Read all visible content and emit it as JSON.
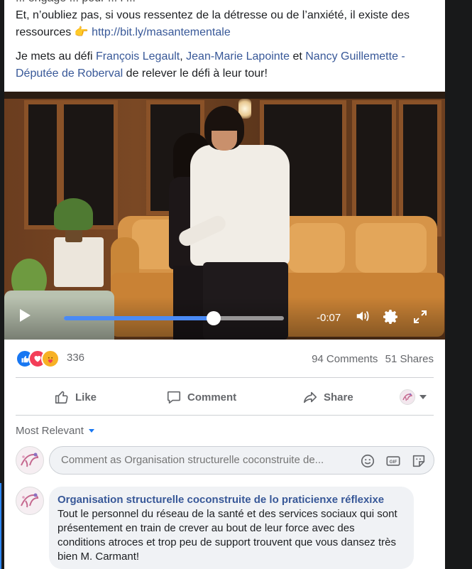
{
  "post": {
    "cut_line": "... engagé ... pour ... l ...",
    "line1_text": "Et, n’oubliez pas, si vous ressentez de la détresse ou de l’anxiété, il existe des ressources 👉 ",
    "line1_link": "http://bit.ly/masantementale",
    "line2_prefix": "Je mets au défi ",
    "tag1": "François Legault",
    "tag_sep1": ", ",
    "tag2": "Jean-Marie Lapointe",
    "tag_sep2": " et ",
    "tag3": "Nancy Guillemette - Députée de Roberval",
    "line2_suffix": " de relever le défi à leur tour!"
  },
  "video": {
    "time_remaining": "-0:07",
    "progress_percent": 68
  },
  "reactions": {
    "count": "336",
    "comments": "94 Comments",
    "shares": "51 Shares"
  },
  "actions": {
    "like": "Like",
    "comment": "Comment",
    "share": "Share"
  },
  "comments": {
    "sort_label": "Most Relevant",
    "input_placeholder": "Comment as Organisation structurelle coconstruite de...",
    "items": [
      {
        "author": "Organisation structurelle coconstruite de lo praticienxe réflexixe",
        "text": " Tout le personnel du réseau de la santé et des services sociaux qui sont présentement en train de crever au bout de leur force avec des conditions atroces et trop peu de support trouvent que vous dansez très bien M. Carmant!"
      }
    ]
  },
  "colors": {
    "link": "#385898",
    "accent": "#1877f2",
    "progress": "#4a8af4"
  }
}
